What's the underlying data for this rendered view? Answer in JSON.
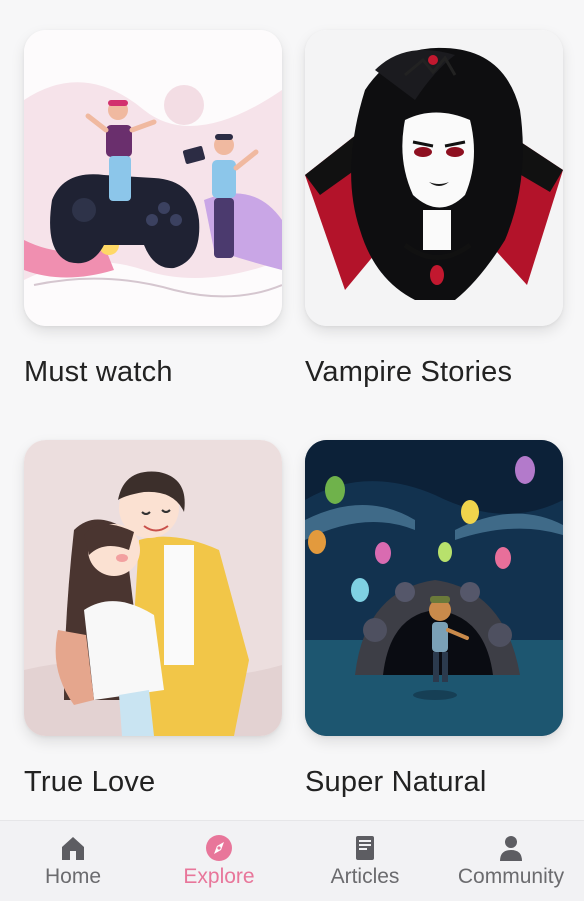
{
  "cards": [
    {
      "title": "Must watch",
      "image": "gamers-illustration"
    },
    {
      "title": "Vampire Stories",
      "image": "vampire-woman-illustration"
    },
    {
      "title": "True Love",
      "image": "couple-illustration"
    },
    {
      "title": "Super Natural",
      "image": "owls-cave-illustration"
    }
  ],
  "nav": {
    "active": "Explore",
    "items": [
      {
        "label": "Home",
        "icon": "home-icon"
      },
      {
        "label": "Explore",
        "icon": "compass-icon"
      },
      {
        "label": "Articles",
        "icon": "book-icon"
      },
      {
        "label": "Community",
        "icon": "person-icon"
      }
    ]
  },
  "colors": {
    "accent": "#e8769a",
    "inactive": "#6b6b6e",
    "background": "#f7f7f8"
  }
}
